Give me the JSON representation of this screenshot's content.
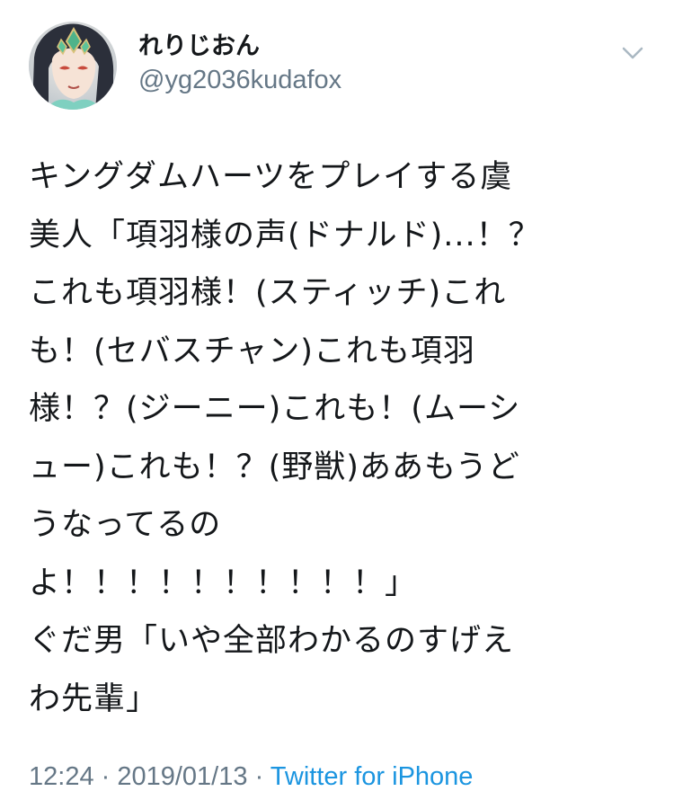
{
  "tweet": {
    "author": {
      "display_name": "れりじおん",
      "handle": "@yg2036kudafox",
      "avatar_icon": "avatar-illustration-icon"
    },
    "menu_icon": "chevron-down-icon",
    "body": {
      "paragraph_1": "キングダムハーツをプレイする虞\n美人「項羽様の声(ドナルド)...！？\nこれも項羽様！(スティッチ)これ\nも！(セバスチャン)これも項羽\n様！？(ジーニー)これも！(ムーシ\nュー)これも！？(野獣)ああもうど\nうなってるの\nよ！！！！！！！！！！」",
      "paragraph_2": "ぐだ男「いや全部わかるのすげえ\nわ先輩」"
    },
    "meta": {
      "time": "12:24",
      "separator_1": " · ",
      "date": "2019/01/13",
      "separator_2": " · ",
      "source": "Twitter for iPhone"
    },
    "colors": {
      "text": "#14171a",
      "secondary": "#657786",
      "link": "#1b95e0"
    }
  }
}
